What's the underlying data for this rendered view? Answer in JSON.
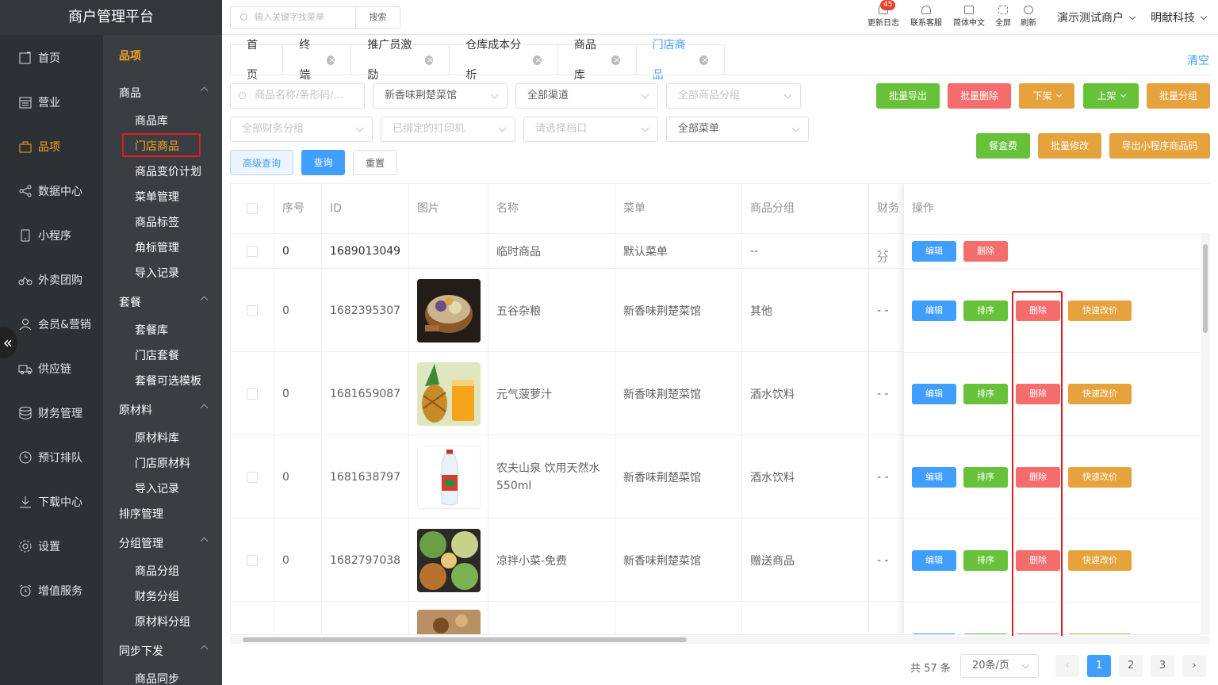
{
  "app": {
    "title": "商户管理平台"
  },
  "rail": {
    "items": [
      "首页",
      "营业",
      "品项",
      "数据中心",
      "小程序",
      "外卖团购",
      "会员&营销",
      "供应链",
      "财务管理",
      "预订排队",
      "下载中心",
      "设置",
      "增值服务"
    ],
    "active": "品项"
  },
  "submenu": {
    "title": "品项",
    "groups": [
      {
        "label": "商品",
        "items": [
          "商品库",
          "门店商品",
          "商品变价计划",
          "菜单管理",
          "商品标签",
          "角标管理",
          "导入记录"
        ]
      },
      {
        "label": "套餐",
        "items": [
          "套餐库",
          "门店套餐",
          "套餐可选模板"
        ]
      },
      {
        "label": "原材料",
        "items": [
          "原材料库",
          "门店原材料",
          "导入记录"
        ]
      },
      {
        "label": "排序管理",
        "items": []
      },
      {
        "label": "分组管理",
        "items": [
          "商品分组",
          "财务分组",
          "原材料分组"
        ]
      },
      {
        "label": "同步下发",
        "items": [
          "商品同步"
        ]
      }
    ],
    "collapse_glyph": "«"
  },
  "topbar": {
    "search_placeholder": "输入关键字找菜单",
    "search_button": "搜索",
    "tools": [
      {
        "label": "更新日志",
        "badge": "45"
      },
      {
        "label": "联系客服"
      },
      {
        "label": "简体中文"
      },
      {
        "label": "全屏"
      },
      {
        "label": "刷新"
      }
    ],
    "store": "演示测试商户",
    "company": "明献科技"
  },
  "tabs": {
    "items": [
      {
        "label": "首页",
        "closable": false
      },
      {
        "label": "终端",
        "closable": true
      },
      {
        "label": "推广员激励",
        "closable": true
      },
      {
        "label": "仓库成本分析",
        "closable": true
      },
      {
        "label": "商品库",
        "closable": true
      },
      {
        "label": "门店商品",
        "closable": true,
        "active": true
      }
    ],
    "clear": "清空"
  },
  "filters": {
    "keyword_placeholder": "商品名称/条形码/...",
    "store": "新香味荆楚菜馆",
    "channel": "全部渠道",
    "group_placeholder": "全部商品分组",
    "finance_placeholder": "全部财务分组",
    "printer_placeholder": "已绑定的打印机",
    "stall_placeholder": "请选择档口",
    "menu": "全部菜单",
    "advanced": "高级查询",
    "query": "查询",
    "reset": "重置"
  },
  "actions": {
    "export": "批量导出",
    "batch_delete": "批量删除",
    "off_shelf": "下架",
    "on_shelf": "上架",
    "batch_group": "批量分组",
    "box_fee": "餐盒费",
    "batch_edit": "批量修改",
    "export_qr": "导出小程序商品码"
  },
  "table": {
    "headers": [
      "序号",
      "ID",
      "图片",
      "名称",
      "菜单",
      "商品分组",
      "财务分",
      "操作"
    ],
    "rows": [
      {
        "seq": "0",
        "id": "1689013049",
        "name": "临时商品",
        "menu": "默认菜单",
        "group": "--",
        "finance": "- -",
        "image": false,
        "ops": [
          "编辑",
          "删除"
        ]
      },
      {
        "seq": "0",
        "id": "1682395307",
        "name": "五谷杂粮",
        "menu": "新香味荆楚菜馆",
        "group": "其他",
        "finance": "- -",
        "image": "grain-bowl-photo",
        "ops": [
          "编辑",
          "排序",
          "删除",
          "快速改价"
        ]
      },
      {
        "seq": "0",
        "id": "1681659087",
        "name": "元气菠萝汁",
        "menu": "新香味荆楚菜馆",
        "group": "酒水饮料",
        "finance": "- -",
        "image": "pineapple-juice-photo",
        "ops": [
          "编辑",
          "排序",
          "删除",
          "快速改价"
        ]
      },
      {
        "seq": "0",
        "id": "1681638797",
        "name": "农夫山泉 饮用天然水550ml",
        "menu": "新香味荆楚菜馆",
        "group": "酒水饮料",
        "finance": "- -",
        "image": "water-bottle-photo",
        "ops": [
          "编辑",
          "排序",
          "删除",
          "快速改价"
        ]
      },
      {
        "seq": "0",
        "id": "1682797038",
        "name": "凉拌小菜-免费",
        "menu": "新香味荆楚菜馆",
        "group": "赠送商品",
        "finance": "- -",
        "image": "cold-dishes-photo",
        "ops": [
          "编辑",
          "排序",
          "删除",
          "快速改价"
        ]
      }
    ]
  },
  "pagination": {
    "total": "共 57 条",
    "page_size": "20条/页",
    "pages": [
      "1",
      "2",
      "3"
    ],
    "current": "1"
  },
  "colors": {
    "accent": "#409eff",
    "success": "#67c23a",
    "danger": "#f56c6c",
    "warning": "#e6a23c",
    "highlight": "#e02020",
    "menu_active": "#f5a623"
  }
}
